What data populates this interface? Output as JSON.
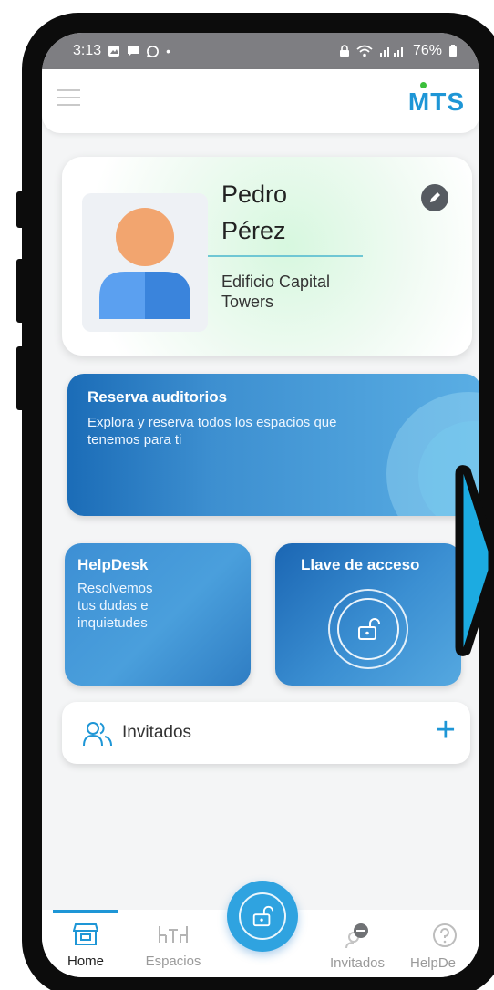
{
  "status_bar": {
    "time": "3:13",
    "battery": "76%"
  },
  "app_bar": {
    "logo": "MTS"
  },
  "profile": {
    "first_name": "Pedro",
    "last_name": "Pérez",
    "building_line1": "Edificio Capital",
    "building_line2": "Towers"
  },
  "tiles": {
    "reserva": {
      "title": "Reserva auditorios",
      "description_line1": "Explora y reserva todos los espacios que",
      "description_line2": "tenemos para ti"
    },
    "helpdesk": {
      "title": "HelpDesk",
      "description_line1": "Resolvemos",
      "description_line2": "tus dudas e",
      "description_line3": "inquietudes"
    },
    "llave": {
      "title": "Llave de acceso"
    }
  },
  "invitados": {
    "label": "Invitados",
    "add_symbol": "+"
  },
  "bottom_nav": {
    "items": [
      {
        "label": "Home",
        "icon": "store-icon"
      },
      {
        "label": "Espacios",
        "icon": "tables-icon"
      },
      {
        "label": "Invitados",
        "icon": "user-minus-icon"
      },
      {
        "label": "HelpDe",
        "icon": "help-circle-icon"
      }
    ],
    "fab_icon": "unlock-icon"
  },
  "colors": {
    "accent": "#1e96d6",
    "tile_blue": "#3d8fd0",
    "status_bar": "#7e7e82",
    "side_arrow": "#1cabe1"
  }
}
